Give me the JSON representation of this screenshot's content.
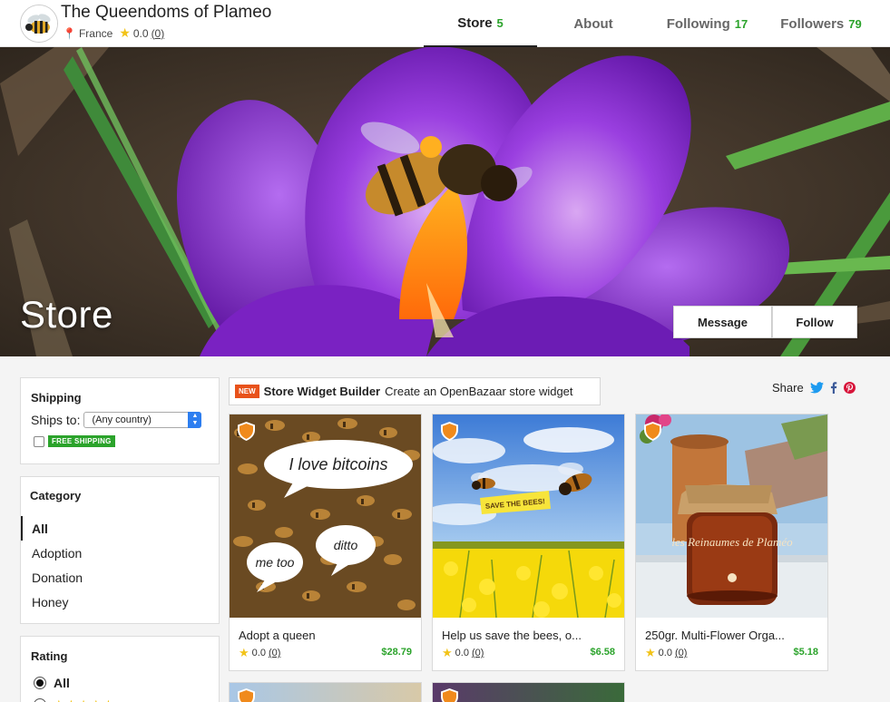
{
  "store": {
    "name": "The Queendoms of Plameo",
    "location": "France",
    "rating": "0.0",
    "rating_count": "(0)"
  },
  "nav": [
    {
      "label": "Store",
      "count": "5"
    },
    {
      "label": "About",
      "count": ""
    },
    {
      "label": "Following",
      "count": "17"
    },
    {
      "label": "Followers",
      "count": "79"
    }
  ],
  "hero": {
    "title": "Store",
    "message_label": "Message",
    "follow_label": "Follow"
  },
  "filters": {
    "shipping_title": "Shipping",
    "ships_to_label": "Ships to:",
    "ships_to_value": "(Any country)",
    "free_shipping_label": "FREE SHIPPING",
    "category_title": "Category",
    "categories": [
      "All",
      "Adoption",
      "Donation",
      "Honey"
    ],
    "rating_title": "Rating",
    "rating_all_label": "All"
  },
  "widget": {
    "badge": "NEW",
    "title": "Store Widget Builder",
    "description": "Create an OpenBazaar store widget"
  },
  "share": {
    "label": "Share"
  },
  "products": [
    {
      "name": "Adopt a queen",
      "rating": "0.0",
      "rating_count": "(0)",
      "price": "$28.79",
      "image_texts": [
        "I love bitcoins",
        "ditto",
        "me too"
      ]
    },
    {
      "name": "Help us save the bees, o...",
      "rating": "0.0",
      "rating_count": "(0)",
      "price": "$6.58",
      "image_texts": [
        "SAVE THE BEES!"
      ]
    },
    {
      "name": "250gr. Multi-Flower Orga...",
      "rating": "0.0",
      "rating_count": "(0)",
      "price": "$5.18",
      "image_texts": [
        "les Reinaumes de Plaméo"
      ]
    }
  ],
  "colors": {
    "accent_green": "#2ba32b",
    "new_badge": "#e8521b",
    "hero_purple": "#8a2fd1"
  }
}
